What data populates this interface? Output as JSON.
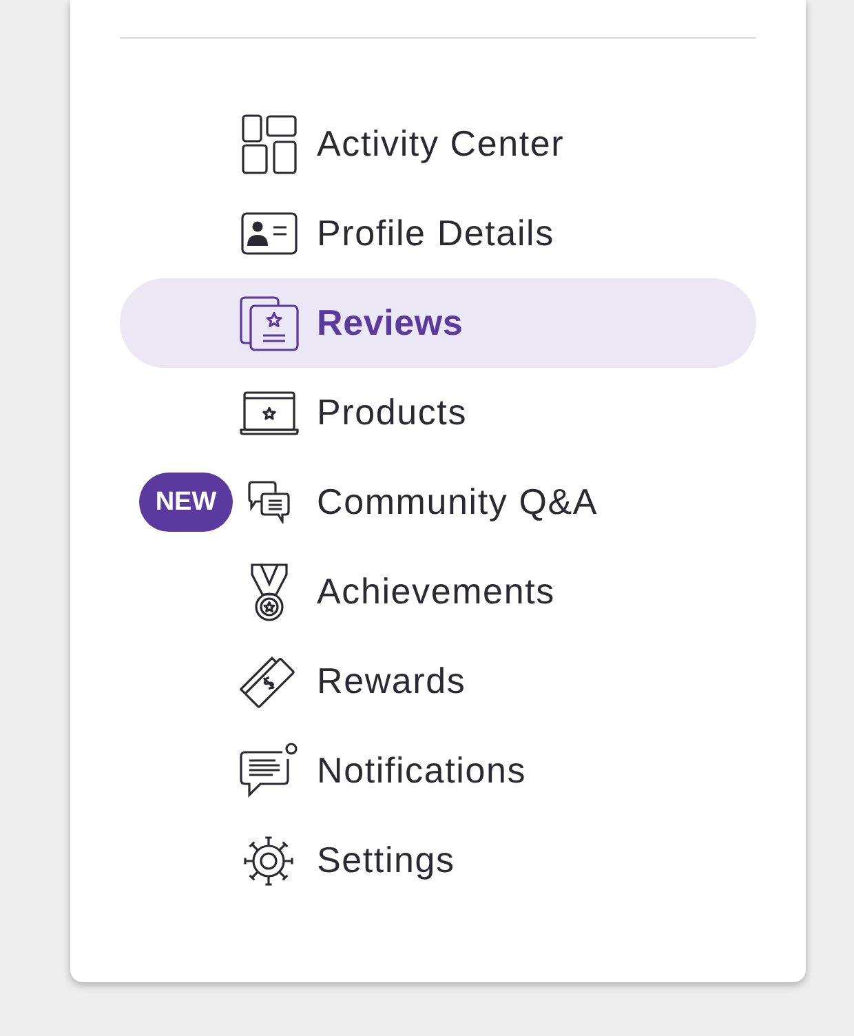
{
  "menu": {
    "items": [
      {
        "label": "Activity Center",
        "selected": false
      },
      {
        "label": "Profile Details",
        "selected": false
      },
      {
        "label": "Reviews",
        "selected": true
      },
      {
        "label": "Products",
        "selected": false
      },
      {
        "label": "Community Q&A",
        "selected": false,
        "badge": "NEW"
      },
      {
        "label": "Achievements",
        "selected": false
      },
      {
        "label": "Rewards",
        "selected": false
      },
      {
        "label": "Notifications",
        "selected": false
      },
      {
        "label": "Settings",
        "selected": false
      }
    ]
  }
}
